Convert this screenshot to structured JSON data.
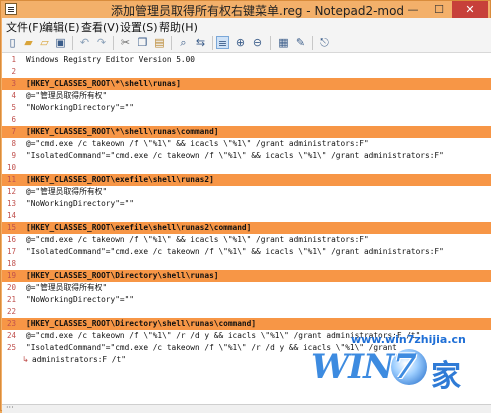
{
  "window": {
    "title": "添加管理员取得所有权右键菜单.reg - Notepad2-mod",
    "minimize": "—",
    "maximize": "☐",
    "close": "✕"
  },
  "menu": [
    "文件(F)",
    "编辑(E)",
    "查看(V)",
    "设置(S)",
    "帮助(H)"
  ],
  "toolbar": {
    "icons": [
      "new-file-icon",
      "open-file-icon",
      "browse-icon",
      "save-icon",
      "undo-icon",
      "redo-icon",
      "cut-icon",
      "copy-icon",
      "paste-icon",
      "find-icon",
      "replace-icon",
      "word-wrap-icon",
      "zoom-in-icon",
      "zoom-out-icon",
      "scheme-icon",
      "customize-icon",
      "exit-icon"
    ]
  },
  "lines": [
    {
      "n": "1",
      "text": "Windows Registry Editor Version 5.00",
      "hl": false
    },
    {
      "n": "2",
      "text": "",
      "hl": false
    },
    {
      "n": "3",
      "text": "[HKEY_CLASSES_ROOT\\*\\shell\\runas]",
      "hl": true
    },
    {
      "n": "4",
      "text": "@=\"管理员取得所有权\"",
      "hl": false
    },
    {
      "n": "5",
      "text": "\"NoWorkingDirectory\"=\"\"",
      "hl": false
    },
    {
      "n": "6",
      "text": "",
      "hl": false
    },
    {
      "n": "7",
      "text": "[HKEY_CLASSES_ROOT\\*\\shell\\runas\\command]",
      "hl": true
    },
    {
      "n": "8",
      "text": "@=\"cmd.exe /c takeown /f \\\"%1\\\" && icacls \\\"%1\\\" /grant administrators:F\"",
      "hl": false
    },
    {
      "n": "9",
      "text": "\"IsolatedCommand\"=\"cmd.exe /c takeown /f \\\"%1\\\" && icacls \\\"%1\\\" /grant administrators:F\"",
      "hl": false
    },
    {
      "n": "10",
      "text": "",
      "hl": false
    },
    {
      "n": "11",
      "text": "[HKEY_CLASSES_ROOT\\exefile\\shell\\runas2]",
      "hl": true
    },
    {
      "n": "12",
      "text": "@=\"管理员取得所有权\"",
      "hl": false
    },
    {
      "n": "13",
      "text": "\"NoWorkingDirectory\"=\"\"",
      "hl": false
    },
    {
      "n": "14",
      "text": "",
      "hl": false
    },
    {
      "n": "15",
      "text": "[HKEY_CLASSES_ROOT\\exefile\\shell\\runas2\\command]",
      "hl": true
    },
    {
      "n": "16",
      "text": "@=\"cmd.exe /c takeown /f \\\"%1\\\" && icacls \\\"%1\\\" /grant administrators:F\"",
      "hl": false
    },
    {
      "n": "17",
      "text": "\"IsolatedCommand\"=\"cmd.exe /c takeown /f \\\"%1\\\" && icacls \\\"%1\\\" /grant administrators:F\"",
      "hl": false
    },
    {
      "n": "18",
      "text": "",
      "hl": false
    },
    {
      "n": "19",
      "text": "[HKEY_CLASSES_ROOT\\Directory\\shell\\runas]",
      "hl": true
    },
    {
      "n": "20",
      "text": "@=\"管理员取得所有权\"",
      "hl": false
    },
    {
      "n": "21",
      "text": "\"NoWorkingDirectory\"=\"\"",
      "hl": false
    },
    {
      "n": "22",
      "text": "",
      "hl": false
    },
    {
      "n": "23",
      "text": "[HKEY_CLASSES_ROOT\\Directory\\shell\\runas\\command]",
      "hl": true
    },
    {
      "n": "24",
      "text": "@=\"cmd.exe /c takeown /f \\\"%1\\\" /r /d y && icacls \\\"%1\\\" /grant administrators:F /t\"",
      "hl": false
    },
    {
      "n": "25",
      "text": "\"IsolatedCommand\"=\"cmd.exe /c takeown /f \\\"%1\\\" /r /d y && icacls \\\"%1\\\" /grant",
      "hl": false
    },
    {
      "n": "",
      "text": "administrators:F /t\"",
      "hl": false,
      "wrap": true
    }
  ],
  "watermark": {
    "url": "www.win7zhijia.cn",
    "logo": "WIN7",
    "jia": "家"
  }
}
